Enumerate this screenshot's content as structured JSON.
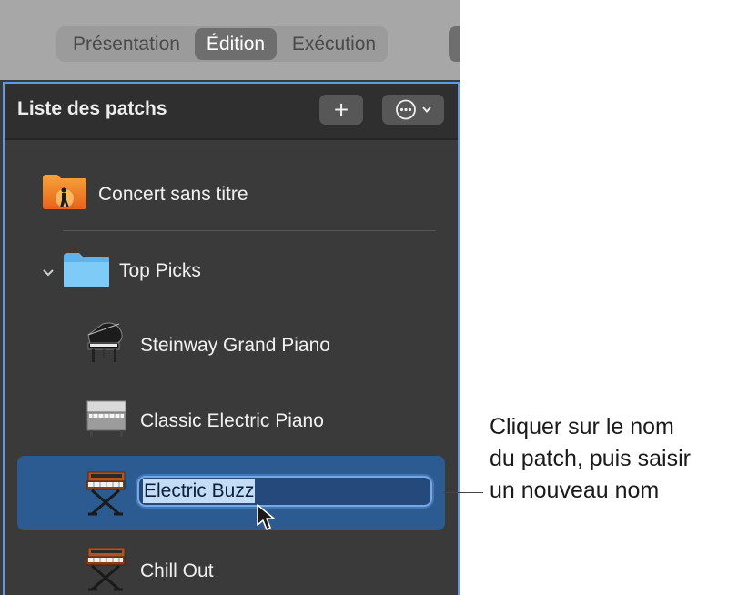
{
  "toolbar": {
    "tabs": [
      {
        "label": "Présentation"
      },
      {
        "label": "Édition",
        "active": true
      },
      {
        "label": "Exécution"
      }
    ]
  },
  "panel": {
    "title": "Liste des patchs",
    "add_button": "+",
    "more_icon": "ellipsis-circle-icon",
    "items": [
      {
        "label": "Concert sans titre",
        "icon": "concert-folder-icon"
      },
      {
        "label": "Top Picks",
        "icon": "folder-icon",
        "expanded": true
      },
      {
        "label": "Steinway Grand Piano",
        "icon": "grand-piano-icon"
      },
      {
        "label": "Classic Electric Piano",
        "icon": "electric-piano-icon"
      },
      {
        "label": "Electric Buzz",
        "icon": "synth-keyboard-icon",
        "selected": true,
        "editing": true
      },
      {
        "label": "Chill Out",
        "icon": "synth-keyboard-icon"
      }
    ]
  },
  "callout": {
    "lines": [
      "Cliquer sur le nom",
      "du patch, puis saisir",
      "un nouveau nom"
    ]
  },
  "colors": {
    "selection": "#2c5b92",
    "focus_ring": "#5a9bf0",
    "panel_bg": "#3a3a3a"
  }
}
